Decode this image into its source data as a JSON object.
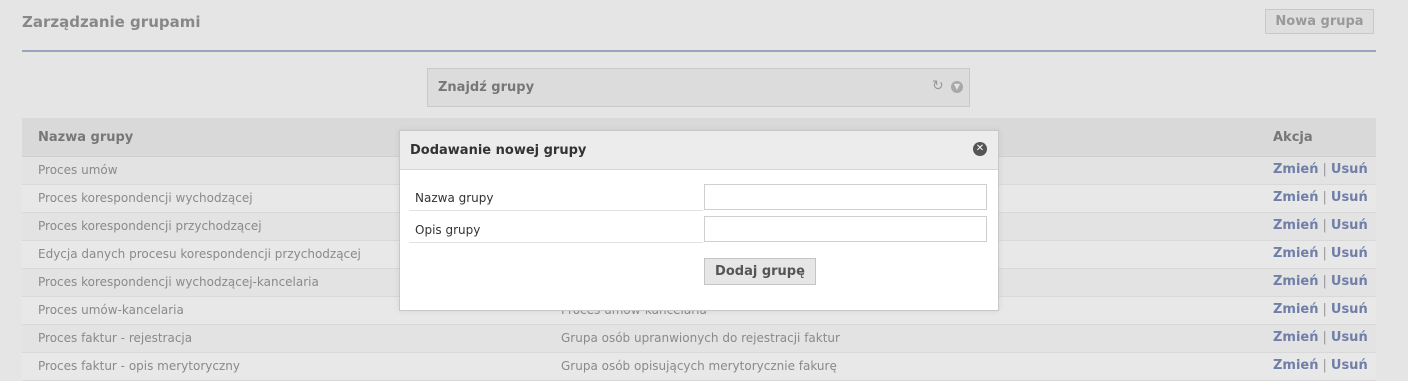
{
  "header": {
    "title": "Zarządzanie grupami",
    "new_group_label": "Nowa grupa"
  },
  "find_panel": {
    "title": "Znajdź grupy",
    "refresh_glyph": "↻",
    "expand_glyph": "▼"
  },
  "table": {
    "columns": {
      "name": "Nazwa grupy",
      "action": "Akcja"
    },
    "action_edit": "Zmień",
    "action_separator": "|",
    "action_delete": "Usuń",
    "rows": [
      {
        "name": "Proces umów",
        "description": ""
      },
      {
        "name": "Proces korespondencji wychodzącej",
        "description": ""
      },
      {
        "name": "Proces korespondencji przychodzącej",
        "description": ""
      },
      {
        "name": "Edycja danych procesu korespondencji przychodzącej",
        "description": ""
      },
      {
        "name": "Proces korespondencji wychodzącej-kancelaria",
        "description": ""
      },
      {
        "name": "Proces umów-kancelaria",
        "description": "Proces umów-kancelaria"
      },
      {
        "name": "Proces faktur - rejestracja",
        "description": "Grupa osób upranwionych do rejestracji faktur"
      },
      {
        "name": "Proces faktur - opis merytoryczny",
        "description": "Grupa osób opisujących merytorycznie fakurę"
      }
    ]
  },
  "modal": {
    "title": "Dodawanie nowej grupy",
    "close_glyph": "✕",
    "fields": {
      "name_label": "Nazwa grupy",
      "name_value": "",
      "description_label": "Opis grupy",
      "description_value": ""
    },
    "submit_label": "Dodaj grupę"
  },
  "colors": {
    "link": "#6f7fa8",
    "rule": "#9aa4c0",
    "background": "#e5e5e5"
  },
  "icons": {
    "refresh": "refresh-icon",
    "expand": "chevron-down-icon",
    "close": "close-icon"
  }
}
